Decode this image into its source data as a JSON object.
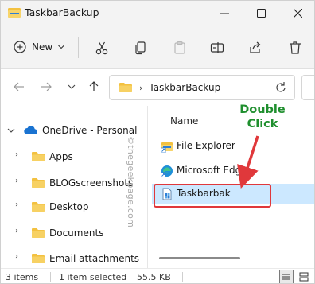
{
  "window": {
    "title": "TaskbarBackup",
    "controls": [
      "minimize",
      "maximize",
      "close"
    ]
  },
  "commandbar": {
    "new_label": "New",
    "icons": [
      "cut-icon",
      "copy-icon",
      "paste-icon",
      "rename-icon",
      "share-icon",
      "delete-icon"
    ]
  },
  "address": {
    "path": "TaskbarBackup"
  },
  "navpane": {
    "items": [
      {
        "label": "OneDrive - Personal",
        "icon": "cloud-icon",
        "expanded": true
      },
      {
        "label": "Apps",
        "icon": "folder-icon"
      },
      {
        "label": "BLOGscreenshots",
        "icon": "folder-icon"
      },
      {
        "label": "Desktop",
        "icon": "folder-icon"
      },
      {
        "label": "Documents",
        "icon": "folder-icon"
      },
      {
        "label": "Email attachments",
        "icon": "folder-icon"
      }
    ]
  },
  "content": {
    "column_name": "Name",
    "files": [
      {
        "label": "File Explorer",
        "icon": "shortcut-explorer-icon",
        "selected": false
      },
      {
        "label": "Microsoft Edge",
        "icon": "edge-icon",
        "selected": false
      },
      {
        "label": "Taskbarbak",
        "icon": "registry-file-icon",
        "selected": true
      }
    ]
  },
  "annotation": {
    "line1": "Double",
    "line2": "Click",
    "color": "#1f8f2e",
    "arrow_color": "#e0383b"
  },
  "watermark": "©thegeekpage.com",
  "statusbar": {
    "item_count": "3 items",
    "selection": "1 item selected",
    "size": "55.5 KB"
  },
  "colors": {
    "folder": "#f3c140",
    "selection": "#cce8ff",
    "chrome": "#f3f3f3"
  }
}
